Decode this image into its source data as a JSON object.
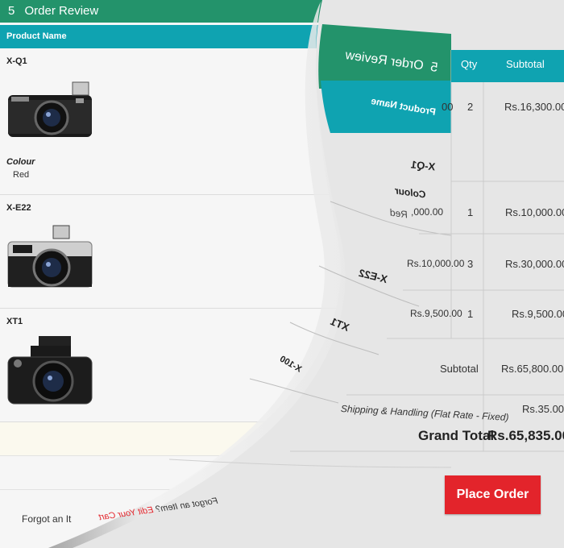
{
  "step": {
    "number": "5",
    "title": "Order Review"
  },
  "table": {
    "col_product": "Product Name",
    "col_qty": "Qty",
    "col_subtotal": "Subtotal"
  },
  "products": [
    {
      "name": "X-Q1",
      "option_label": "Colour",
      "option_value": "Red",
      "price": "Rs.16,300.00",
      "qty": "2",
      "subtotal": "Rs.16,300.00"
    },
    {
      "name": "X-E22",
      "price": "Rs.10,000.00",
      "qty": "1",
      "subtotal": "Rs.10,000.00"
    },
    {
      "name": "X-E22",
      "price": "Rs.10,000.00",
      "qty": "3",
      "subtotal": "Rs.30,000.00"
    },
    {
      "name": "XT1",
      "price": "Rs.9,500.00",
      "qty": "1",
      "subtotal": "Rs.9,500.00"
    },
    {
      "name": "X-100"
    }
  ],
  "totals": {
    "subtotal_label": "Subtotal",
    "subtotal_value": "Rs.65,800.00",
    "shipping_label": "Shipping & Handling (Flat Rate - Fixed)",
    "shipping_value": "Rs.35.00",
    "grand_label": "Grand Total",
    "grand_value": "Rs.65,835.00"
  },
  "actions": {
    "place_order": "Place Order",
    "forgot_prefix_left": "Forgot an It",
    "forgot_prefix": "Forgot an Item?",
    "edit_cart": "Edit Your Cart"
  },
  "colors": {
    "header_green": "#23936b",
    "teal": "#0fa3b1",
    "place_order_red": "#e3242b"
  }
}
